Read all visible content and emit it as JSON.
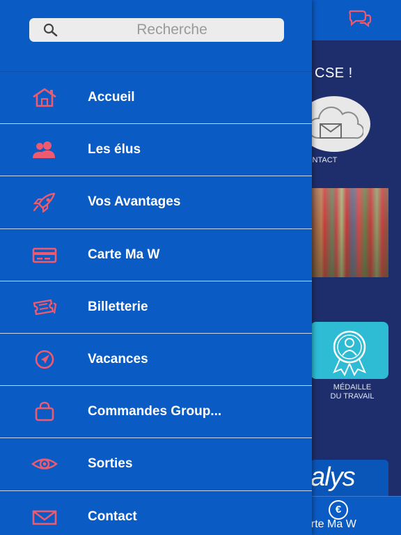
{
  "background": {
    "heading": "CSE !",
    "contact_label": "ONTACT",
    "medal_label_line1": "MÉDAILLE",
    "medal_label_line2": "DU TRAVAIL",
    "logo_text": "alys",
    "bottom_bar_label": "arte Ma W",
    "bottom_bar_icon_glyph": "€",
    "icons": {
      "chat": "chat-bubbles-icon",
      "contact": "cloud-mail-icon",
      "medal": "medal-person-icon",
      "bottom": "euro-icon"
    },
    "colors": {
      "topbar": "#0b5bc4",
      "content": "#1e2d6b",
      "accent": "#f05a6e",
      "tile_teal": "#2dbcd4"
    }
  },
  "drawer": {
    "search": {
      "placeholder": "Recherche",
      "value": "",
      "icon": "search-icon"
    },
    "items": [
      {
        "label": "Accueil",
        "icon": "home-icon"
      },
      {
        "label": "Les élus",
        "icon": "users-icon"
      },
      {
        "label": "Vos Avantages",
        "icon": "rocket-icon"
      },
      {
        "label": "Carte Ma W",
        "icon": "card-icon"
      },
      {
        "label": "Billetterie",
        "icon": "tickets-icon"
      },
      {
        "label": "Vacances",
        "icon": "compass-icon"
      },
      {
        "label": "Commandes Group...",
        "icon": "bag-icon"
      },
      {
        "label": "Sorties",
        "icon": "eye-icon"
      },
      {
        "label": "Contact",
        "icon": "envelope-icon"
      }
    ],
    "colors": {
      "background": "#0b5bc4",
      "icon": "#f05a6e",
      "text": "#ffffff",
      "divider": "#c9d7ee"
    }
  }
}
